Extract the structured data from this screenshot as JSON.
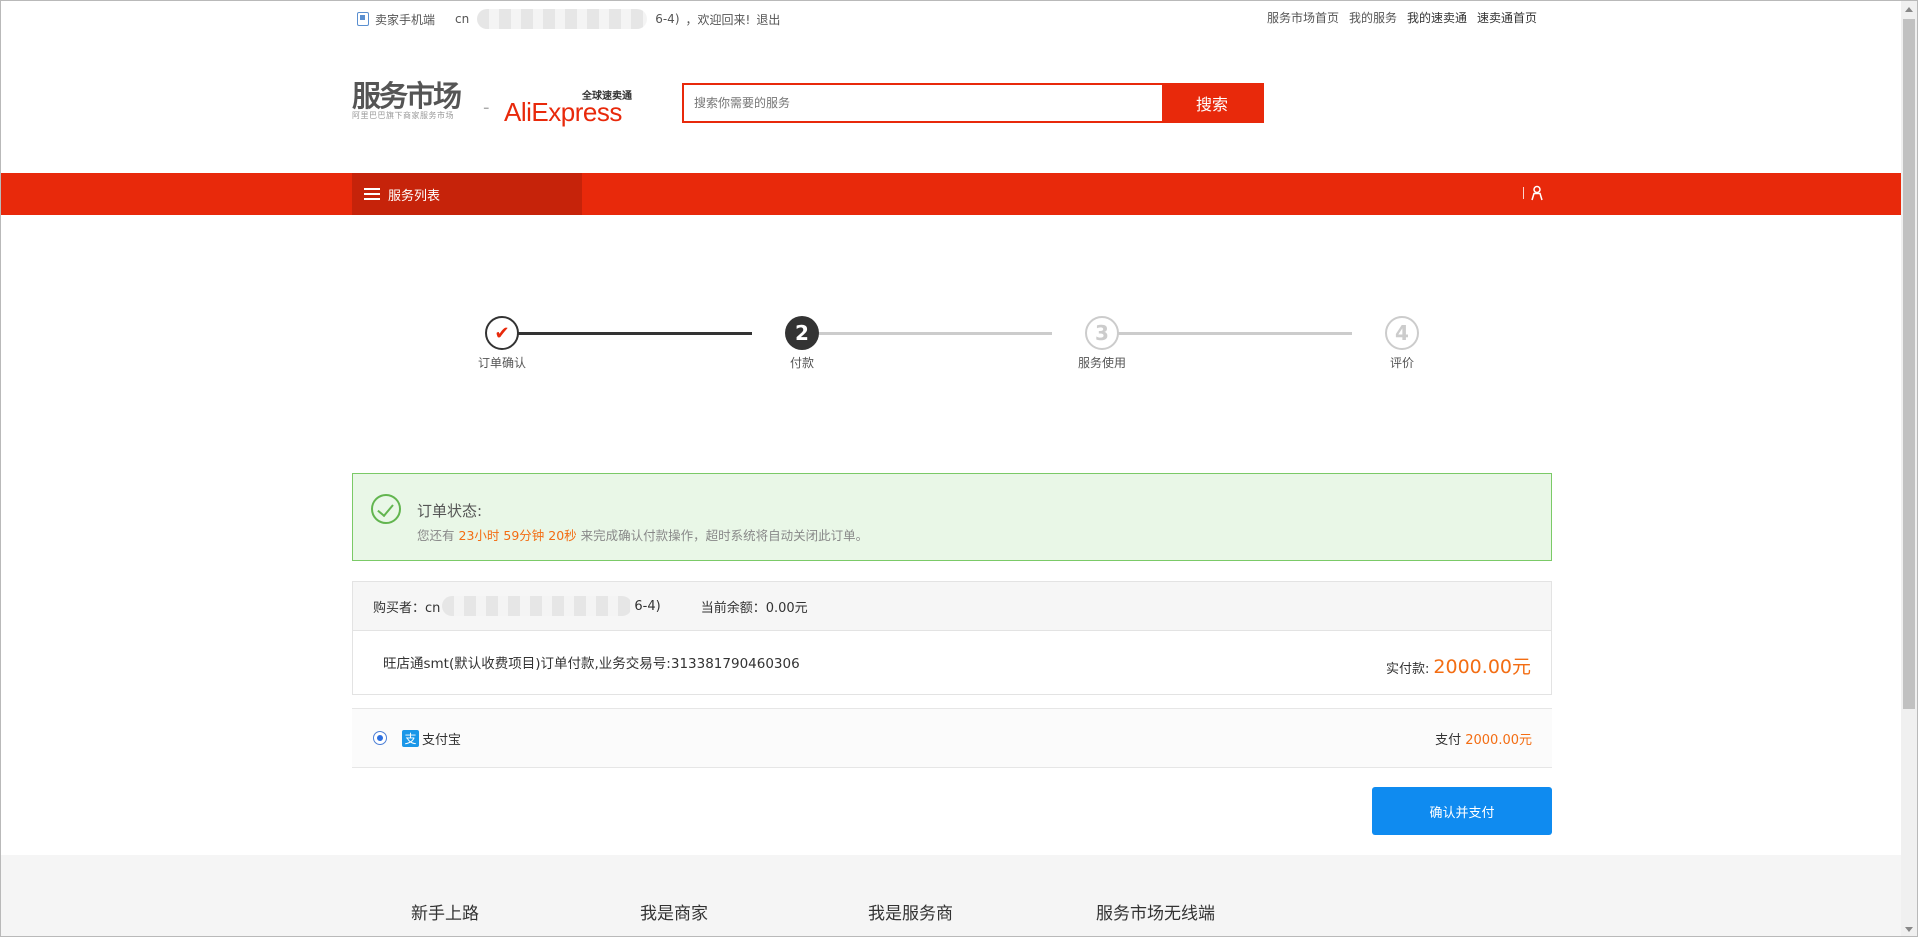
{
  "topbar": {
    "mobile_label": "卖家手机端",
    "user_prefix": "cn",
    "user_suffix": "6-4)",
    "welcome": "，欢迎回来!",
    "logout": "退出",
    "links": [
      "服务市场首页",
      "我的服务",
      "我的速卖通",
      "速卖通首页"
    ]
  },
  "header": {
    "logo_text": "服务市场",
    "logo_sub": "阿里巴巴旗下商家服务市场",
    "ae_cn": "全球速卖通",
    "ae_en": "AliExpress",
    "search_placeholder": "搜索你需要的服务",
    "search_button": "搜索"
  },
  "nav": {
    "category_label": "服务列表"
  },
  "steps": [
    {
      "label": "订单确认",
      "num": "✔",
      "state": "done"
    },
    {
      "label": "付款",
      "num": "2",
      "state": "current"
    },
    {
      "label": "服务使用",
      "num": "3",
      "state": "todo"
    },
    {
      "label": "评价",
      "num": "4",
      "state": "todo"
    }
  ],
  "status": {
    "title": "订单状态:",
    "prefix": "您还有",
    "countdown": "23小时 59分钟 20秒",
    "suffix": "来完成确认付款操作，超时系统将自动关闭此订单。"
  },
  "buyer": {
    "label": "购买者：cn",
    "suffix": "6-4)",
    "balance_label": "当前余额：0.00元"
  },
  "order": {
    "description": "旺店通smt(默认收费项目)订单付款,业务交易号:313381790460306",
    "amount_label": "实付款:",
    "amount": "2000.00元"
  },
  "payment": {
    "method": "支付宝",
    "method_icon": "支",
    "pay_label": "支付",
    "pay_amount": "2000.00元"
  },
  "confirm_button": "确认并支付",
  "footer": {
    "cols": [
      "新手上路",
      "我是商家",
      "我是服务商",
      "服务市场无线端"
    ]
  },
  "colors": {
    "brand_red": "#e8290b",
    "dark_red": "#c6230a",
    "accent_orange": "#f36d13",
    "primary_blue": "#0f8bf0",
    "success_green": "#62b54f"
  }
}
